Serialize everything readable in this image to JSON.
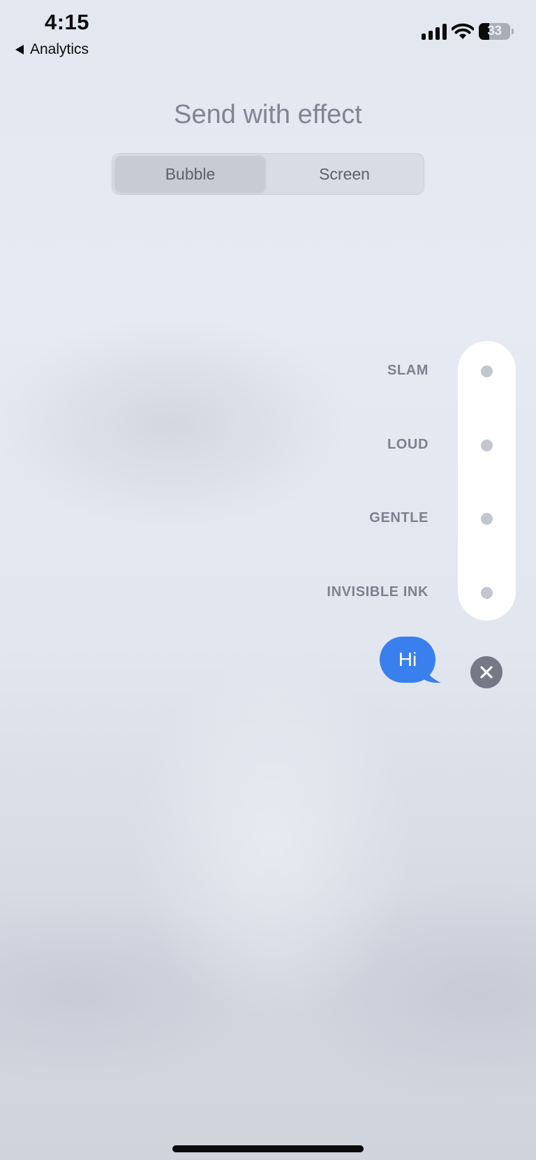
{
  "status_bar": {
    "time": "4:15",
    "back_label": "Analytics",
    "battery_level": "33",
    "battery_fraction": 0.33
  },
  "header": {
    "title": "Send with effect",
    "tabs": [
      {
        "label": "Bubble",
        "selected": true
      },
      {
        "label": "Screen",
        "selected": false
      }
    ]
  },
  "effects": [
    {
      "label": "SLAM"
    },
    {
      "label": "LOUD"
    },
    {
      "label": "GENTLE"
    },
    {
      "label": "INVISIBLE INK"
    }
  ],
  "message": {
    "text": "Hi"
  },
  "colors": {
    "bubble": "#3a7fee",
    "close_button": "#737985",
    "label": "#7b8290"
  },
  "icons": {
    "back": "back-caret-icon",
    "signal": "cellular-signal-icon",
    "wifi": "wifi-icon",
    "battery": "battery-icon",
    "close": "close-icon"
  }
}
